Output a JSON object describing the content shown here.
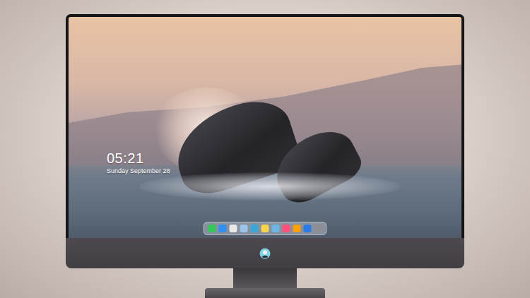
{
  "lock_screen": {
    "time": "05:21",
    "date": "Sunday September 28"
  },
  "dock": {
    "items": [
      {
        "color": "#34c759"
      },
      {
        "color": "#2f8ff0"
      },
      {
        "color": "#e8e8e8"
      },
      {
        "color": "#9cc3e8"
      },
      {
        "color": "#3aa7d8"
      },
      {
        "color": "#f5d34a"
      },
      {
        "color": "#6fb6e8"
      },
      {
        "color": "#ff4f7a"
      },
      {
        "color": "#ff9f0a"
      },
      {
        "color": "#2c7be5"
      },
      {
        "color": "#8e8e93"
      }
    ]
  }
}
